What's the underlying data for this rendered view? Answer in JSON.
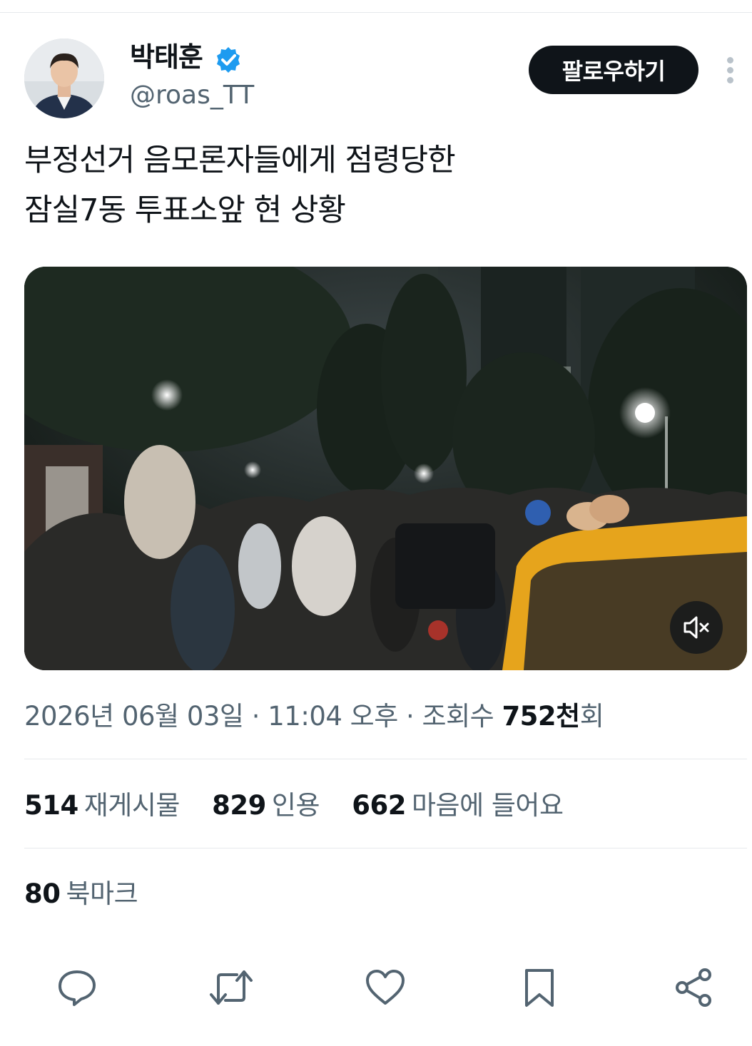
{
  "author": {
    "display_name": "박태훈",
    "handle": "@roas_TT",
    "verified": true,
    "avatar_icon": "profile-photo"
  },
  "follow_label": "팔로우하기",
  "tweet": {
    "text_lines": [
      "부정선거 음모론자들에게 점령당한",
      "잠실7동 투표소앞 현 상황"
    ]
  },
  "media": {
    "type": "video",
    "mute_icon": "speaker-muted-icon"
  },
  "meta": {
    "date": "2026년 06월 03일",
    "separator": " · ",
    "time": "11:04 오후",
    "views_label": "조회수",
    "views_value": "752천",
    "views_suffix": "회"
  },
  "stats": {
    "reposts": {
      "value": "514",
      "label": "재게시물"
    },
    "quotes": {
      "value": "829",
      "label": "인용"
    },
    "likes": {
      "value": "662",
      "label": "마음에 들어요"
    }
  },
  "bookmarks": {
    "value": "80",
    "label": "북마크"
  },
  "actions": [
    "reply-icon",
    "repost-icon",
    "like-icon",
    "bookmark-icon",
    "share-icon"
  ],
  "colors": {
    "text_primary": "#0f1419",
    "text_secondary": "#536471",
    "verified_blue": "#1d9bf0",
    "divider": "#e6e9ec",
    "icon_gray": "#536471"
  }
}
